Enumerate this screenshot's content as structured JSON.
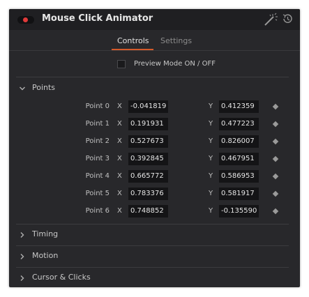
{
  "header": {
    "title": "Mouse Click Animator",
    "accent": "#e03a3a"
  },
  "tabs": [
    {
      "label": "Controls",
      "active": true
    },
    {
      "label": "Settings",
      "active": false
    }
  ],
  "preview": {
    "label": "Preview Mode ON / OFF",
    "checked": false
  },
  "points_section": {
    "label": "Points",
    "axis_x": "X",
    "axis_y": "Y",
    "rows": [
      {
        "label": "Point 0",
        "x": "-0.041819",
        "y": "0.412359"
      },
      {
        "label": "Point 1",
        "x": "0.191931",
        "y": "0.477223"
      },
      {
        "label": "Point 2",
        "x": "0.527673",
        "y": "0.826007"
      },
      {
        "label": "Point 3",
        "x": "0.392845",
        "y": "0.467951"
      },
      {
        "label": "Point 4",
        "x": "0.665772",
        "y": "0.586953"
      },
      {
        "label": "Point 5",
        "x": "0.783376",
        "y": "0.581917"
      },
      {
        "label": "Point 6",
        "x": "0.748852",
        "y": "-0.135590"
      }
    ]
  },
  "collapsed_sections": [
    {
      "label": "Timing"
    },
    {
      "label": "Motion"
    },
    {
      "label": "Cursor & Clicks"
    }
  ],
  "colors": {
    "panel": "#28282b",
    "header": "#1f1f22",
    "tab_accent": "#d45a2a"
  }
}
